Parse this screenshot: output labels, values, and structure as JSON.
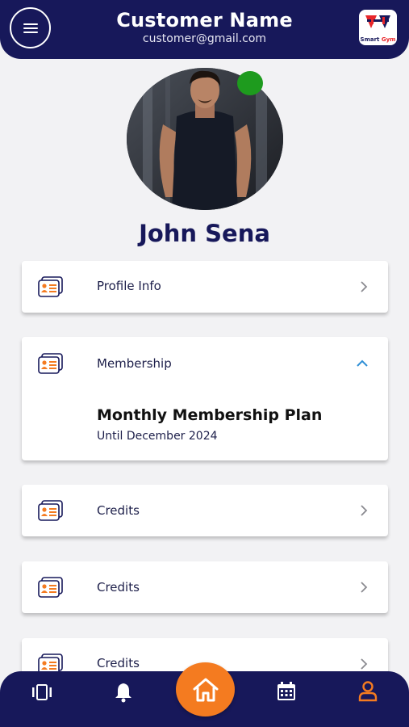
{
  "header": {
    "title": "Customer Name",
    "email": "customer@gmail.com",
    "logo_text_part1": "Smart",
    "logo_text_part2": "Gym"
  },
  "profile": {
    "name": "John Sena",
    "status_color": "#1e9b1e"
  },
  "cards": [
    {
      "label": "Profile Info",
      "icon": "id-card-icon",
      "state": "collapsed"
    },
    {
      "label": "Membership",
      "icon": "id-card-icon",
      "state": "expanded",
      "plan_title": "Monthly Membership Plan",
      "plan_until": "Until December 2024"
    },
    {
      "label": "Credits",
      "icon": "id-card-icon",
      "state": "collapsed"
    },
    {
      "label": "Credits",
      "icon": "id-card-icon",
      "state": "collapsed"
    },
    {
      "label": "Credits",
      "icon": "id-card-icon",
      "state": "collapsed"
    }
  ],
  "bottom_nav": {
    "items": [
      "carousel-icon",
      "bell-icon",
      "home-icon",
      "calendar-icon",
      "profile-icon"
    ],
    "active": "profile-icon"
  },
  "colors": {
    "primary": "#17185a",
    "accent": "#f47b20",
    "background": "#f2f2f4"
  }
}
